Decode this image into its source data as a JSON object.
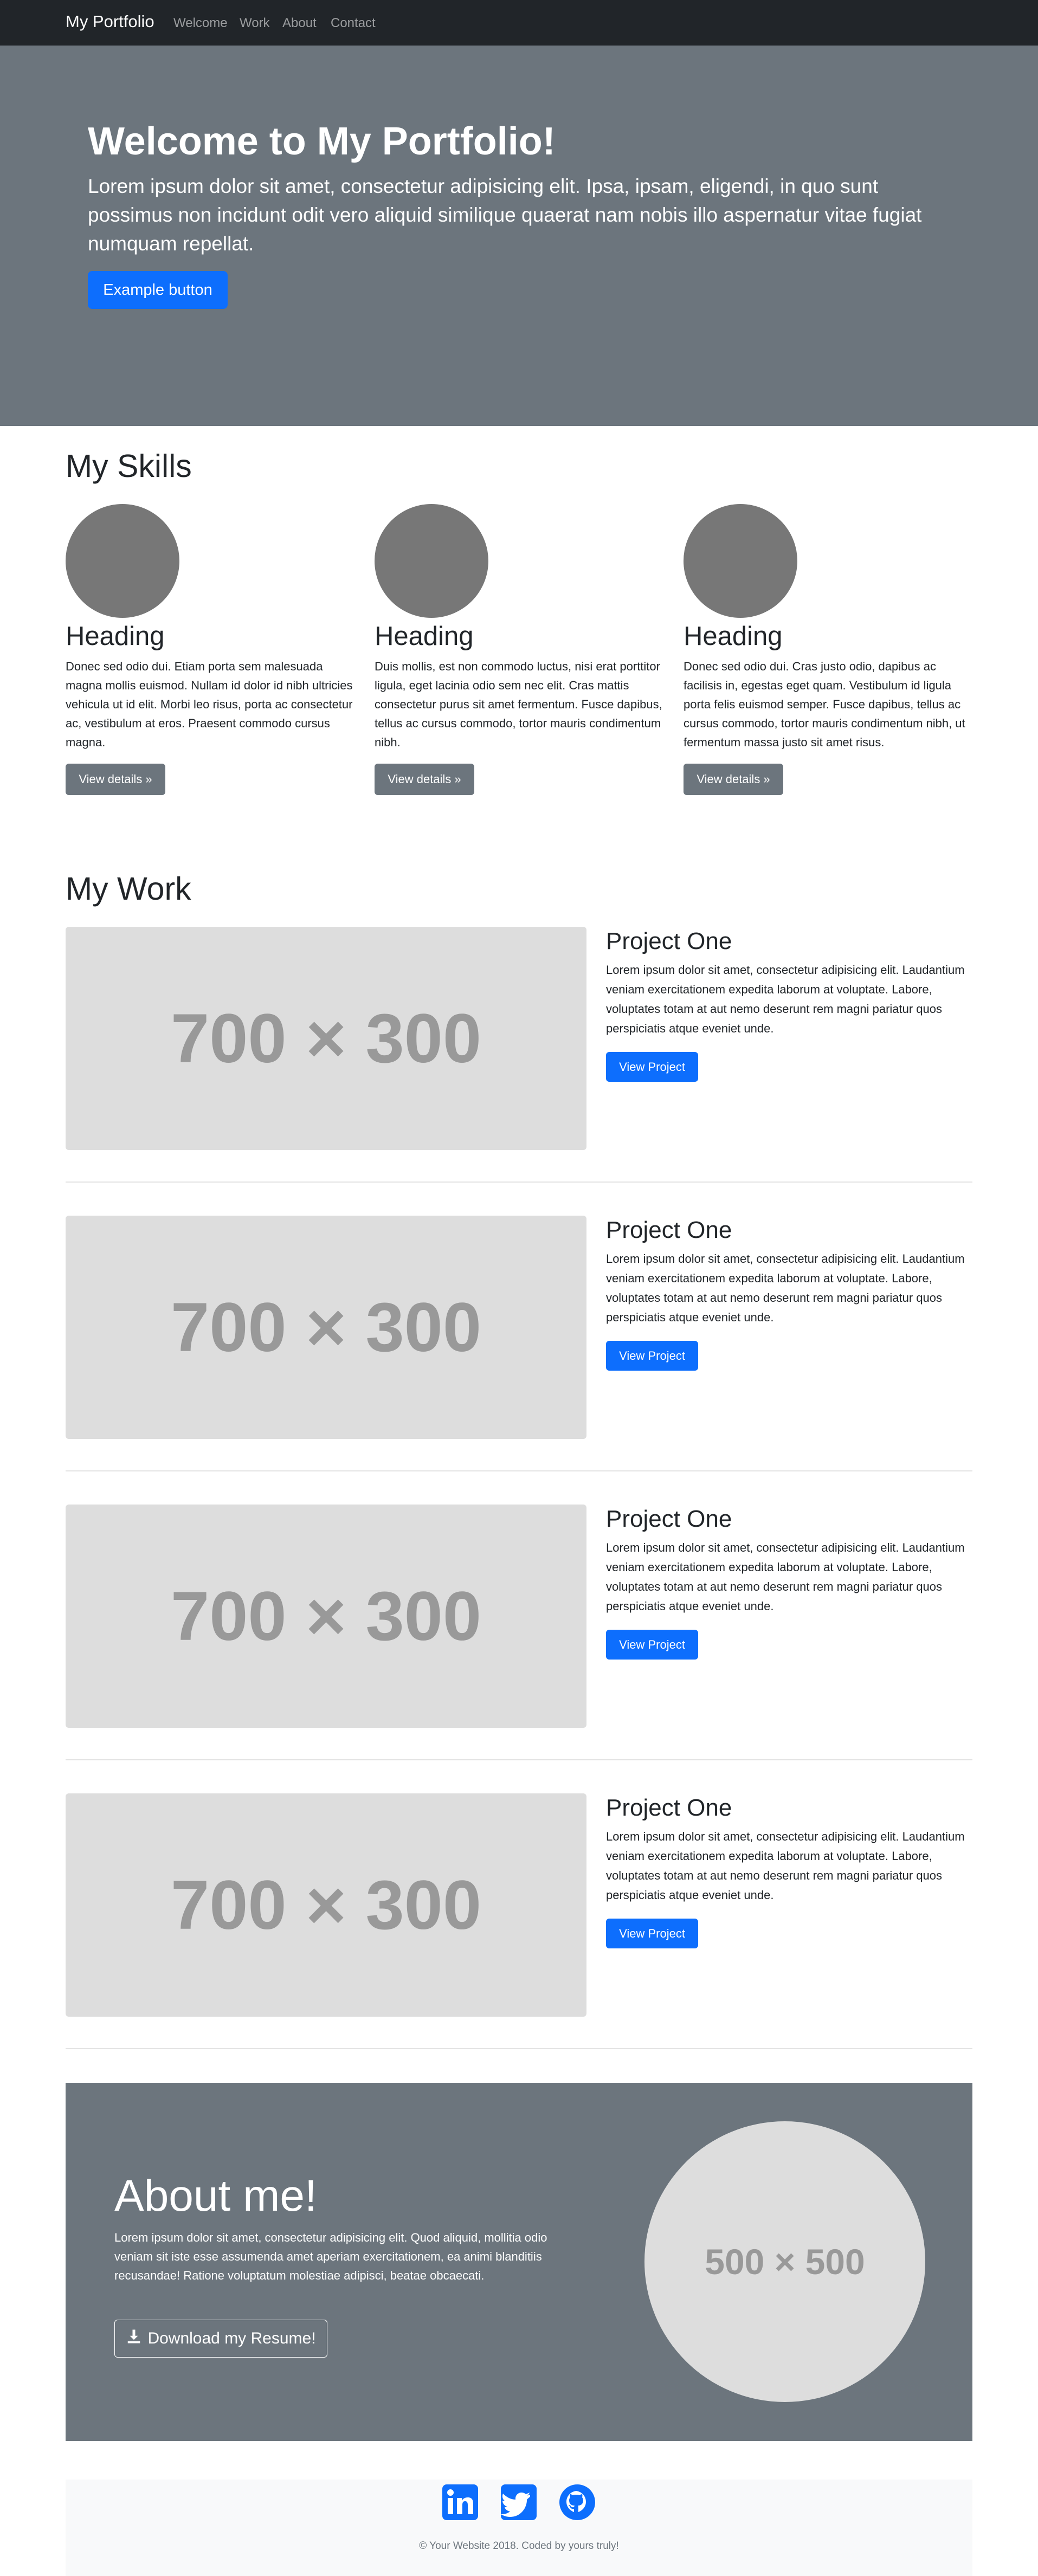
{
  "nav": {
    "brand": "My Portfolio",
    "links": [
      "Welcome",
      "Work",
      "About",
      "Contact"
    ]
  },
  "hero": {
    "title": "Welcome to My Portfolio!",
    "text": "Lorem ipsum dolor sit amet, consectetur adipisicing elit. Ipsa, ipsam, eligendi, in quo sunt possimus non incidunt odit vero aliquid similique quaerat nam nobis illo aspernatur vitae fugiat numquam repellat.",
    "button": "Example button"
  },
  "skills": {
    "title": "My Skills",
    "items": [
      {
        "heading": "Heading",
        "text": "Donec sed odio dui. Etiam porta sem malesuada magna mollis euismod. Nullam id dolor id nibh ultricies vehicula ut id elit. Morbi leo risus, porta ac consectetur ac, vestibulum at eros. Praesent commodo cursus magna.",
        "button": "View details »"
      },
      {
        "heading": "Heading",
        "text": "Duis mollis, est non commodo luctus, nisi erat porttitor ligula, eget lacinia odio sem nec elit. Cras mattis consectetur purus sit amet fermentum. Fusce dapibus, tellus ac cursus commodo, tortor mauris condimentum nibh.",
        "button": "View details »"
      },
      {
        "heading": "Heading",
        "text": "Donec sed odio dui. Cras justo odio, dapibus ac facilisis in, egestas eget quam. Vestibulum id ligula porta felis euismod semper. Fusce dapibus, tellus ac cursus commodo, tortor mauris condimentum nibh, ut fermentum massa justo sit amet risus.",
        "button": "View details »"
      }
    ]
  },
  "work": {
    "title": "My Work",
    "projects": [
      {
        "image": "700 × 300",
        "title": "Project One",
        "text": "Lorem ipsum dolor sit amet, consectetur adipisicing elit. Laudantium veniam exercitationem expedita laborum at voluptate. Labore, voluptates totam at aut nemo deserunt rem magni pariatur quos perspiciatis atque eveniet unde.",
        "button": "View Project"
      },
      {
        "image": "700 × 300",
        "title": "Project One",
        "text": "Lorem ipsum dolor sit amet, consectetur adipisicing elit. Laudantium veniam exercitationem expedita laborum at voluptate. Labore, voluptates totam at aut nemo deserunt rem magni pariatur quos perspiciatis atque eveniet unde.",
        "button": "View Project"
      },
      {
        "image": "700 × 300",
        "title": "Project One",
        "text": "Lorem ipsum dolor sit amet, consectetur adipisicing elit. Laudantium veniam exercitationem expedita laborum at voluptate. Labore, voluptates totam at aut nemo deserunt rem magni pariatur quos perspiciatis atque eveniet unde.",
        "button": "View Project"
      },
      {
        "image": "700 × 300",
        "title": "Project One",
        "text": "Lorem ipsum dolor sit amet, consectetur adipisicing elit. Laudantium veniam exercitationem expedita laborum at voluptate. Labore, voluptates totam at aut nemo deserunt rem magni pariatur quos perspiciatis atque eveniet unde.",
        "button": "View Project"
      }
    ]
  },
  "about": {
    "title": "About me!",
    "text": "Lorem ipsum dolor sit amet, consectetur adipisicing elit. Quod aliquid, mollitia odio veniam sit iste esse assumenda amet aperiam exercitationem, ea animi blanditiis recusandae! Ratione voluptatum molestiae adipisci, beatae obcaecati.",
    "button": "Download my Resume!",
    "image": "500 × 500"
  },
  "footer": {
    "social_icons": [
      "linkedin-icon",
      "twitter-icon",
      "github-icon"
    ],
    "text": "© Your Website 2018. Coded by yours truly!"
  },
  "colors": {
    "primary": "#0d6efd",
    "secondary": "#6c757d",
    "navbar": "#212529",
    "placeholder": "#dddddd"
  }
}
